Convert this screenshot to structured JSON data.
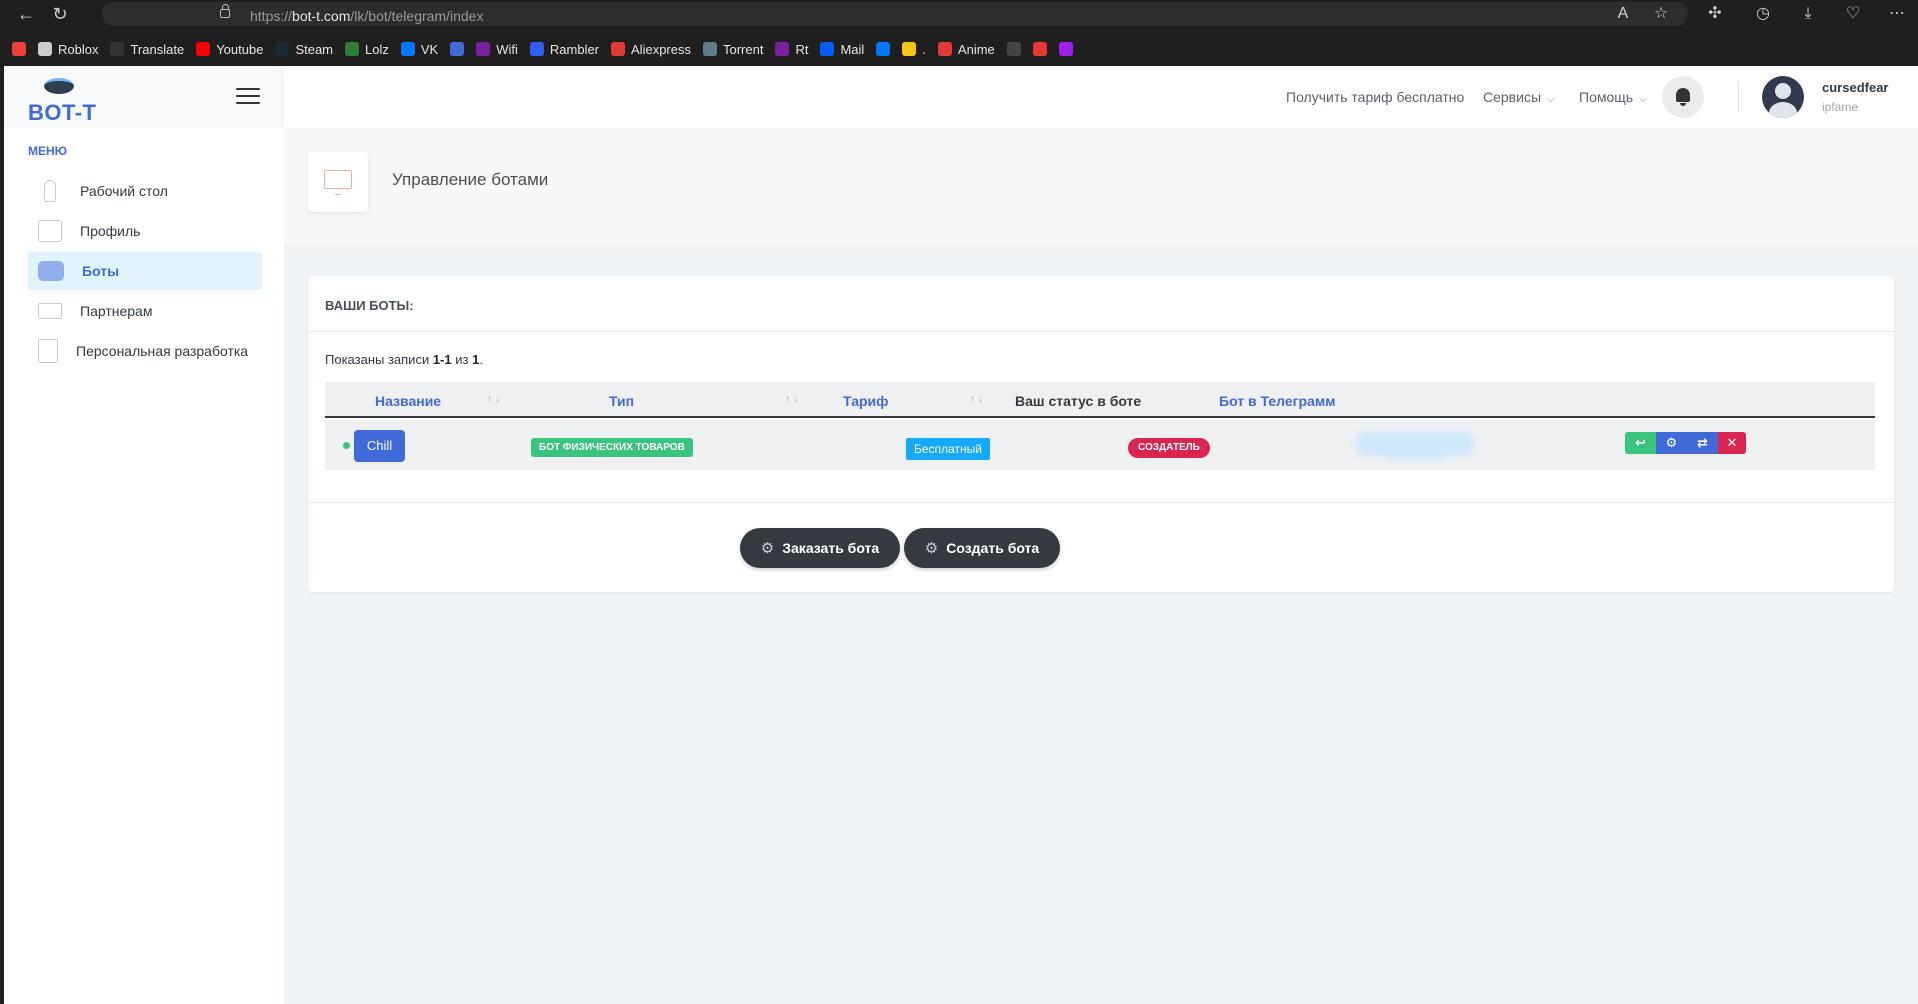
{
  "browser": {
    "url_prefix": "https://",
    "url_domain": "bot-t.com",
    "url_path": "/lk/bot/telegram/index",
    "bookmarks": [
      {
        "label": "",
        "icon": "gmail-icon",
        "color": "#ea4335"
      },
      {
        "label": "Roblox",
        "icon": "roblox-icon",
        "color": "#cccccc"
      },
      {
        "label": "Translate",
        "icon": "translate-icon",
        "color": "#333333"
      },
      {
        "label": "Youtube",
        "icon": "youtube-icon",
        "color": "#ff0000"
      },
      {
        "label": "Steam",
        "icon": "steam-icon",
        "color": "#1b2838"
      },
      {
        "label": "Lolz",
        "icon": "lolz-icon",
        "color": "#2e7d32"
      },
      {
        "label": "VK",
        "icon": "vk-icon",
        "color": "#0077ff"
      },
      {
        "label": "",
        "icon": "f-icon",
        "color": "#3f6ad8"
      },
      {
        "label": "Wifi",
        "icon": "wifi-icon",
        "color": "#7b1fa2"
      },
      {
        "label": "Rambler",
        "icon": "rambler-icon",
        "color": "#315efb"
      },
      {
        "label": "Aliexpress",
        "icon": "aliexpress-icon",
        "color": "#e53935"
      },
      {
        "label": "Torrent",
        "icon": "torrent-icon",
        "color": "#607d8b"
      },
      {
        "label": "Rt",
        "icon": "rt-icon",
        "color": "#7b1fa2"
      },
      {
        "label": "Mail",
        "icon": "mail-icon",
        "color": "#005ff9"
      },
      {
        "label": "",
        "icon": "vk2-icon",
        "color": "#0077ff"
      },
      {
        "label": ".",
        "icon": "folder-icon",
        "color": "#f5c518"
      },
      {
        "label": "Anime",
        "icon": "anime-icon",
        "color": "#e53935"
      },
      {
        "label": "",
        "icon": "bc-icon",
        "color": "#444444"
      },
      {
        "label": "",
        "icon": "a-icon",
        "color": "#e53935"
      },
      {
        "label": "",
        "icon": "wb-icon",
        "color": "#a020f0"
      }
    ]
  },
  "sidebar": {
    "logo": "BOT-T",
    "menu_heading": "МЕНЮ",
    "items": [
      {
        "label": "Рабочий стол",
        "icon": "desktop-icon"
      },
      {
        "label": "Профиль",
        "icon": "profile-icon"
      },
      {
        "label": "Боты",
        "icon": "robot-icon"
      },
      {
        "label": "Партнерам",
        "icon": "partners-icon"
      },
      {
        "label": "Персональная разработка",
        "icon": "development-icon"
      }
    ]
  },
  "header": {
    "free_tariff": "Получить тариф бесплатно",
    "services": "Сервисы",
    "help": "Помощь",
    "username": "cursedfear",
    "usersub": "ipfame"
  },
  "page": {
    "title": "Управление ботами"
  },
  "card": {
    "heading": "ВАШИ БОТЫ:",
    "shown_prefix": "Показаны записи ",
    "shown_range": "1-1",
    "shown_mid": " из ",
    "shown_total": "1",
    "shown_suffix": ".",
    "columns": [
      "Название",
      "Тип",
      "Тариф",
      "Ваш статус в боте",
      "Бот в Телеграмм"
    ],
    "row": {
      "name": "Chill",
      "type": "Бот физических товаров",
      "tariff": "Бесплатный",
      "status": "Создатель",
      "telegram": ""
    },
    "order_button": "Заказать бота",
    "create_button": "Создать бота"
  },
  "colors": {
    "accent": "#3f6ad8",
    "success": "#3ac47d",
    "info": "#16aaff",
    "danger": "#d92550",
    "dark": "#343a40"
  }
}
